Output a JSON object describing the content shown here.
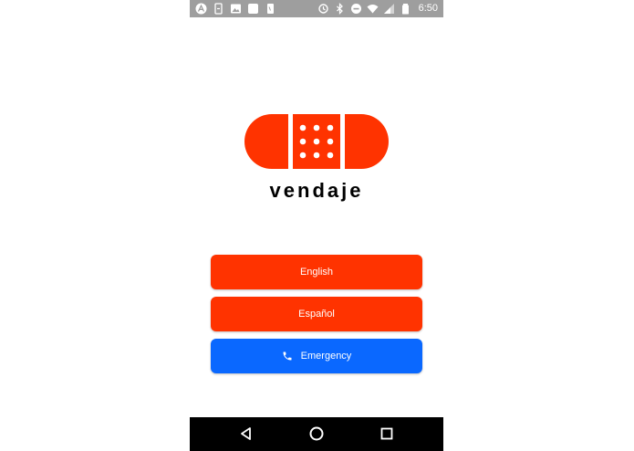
{
  "status_bar": {
    "time": "6:50",
    "left_icons": [
      "android-icon",
      "phone-sync-icon",
      "image-icon",
      "app-icon",
      "phone-icon"
    ],
    "right_icons": [
      "sync-icon",
      "bluetooth-icon",
      "do-not-disturb-icon",
      "wifi-icon",
      "signal-icon",
      "battery-icon"
    ]
  },
  "app": {
    "brand": "vendaje",
    "brand_color": "#ff3300"
  },
  "buttons": {
    "english": "English",
    "espanol": "Español",
    "emergency": "Emergency"
  },
  "colors": {
    "primary": "#ff3300",
    "emergency": "#0a68ff",
    "status_bar": "#9e9e9e",
    "nav_bar": "#000000"
  },
  "nav_bar": {
    "icons": [
      "back-icon",
      "home-icon",
      "recents-icon"
    ]
  }
}
